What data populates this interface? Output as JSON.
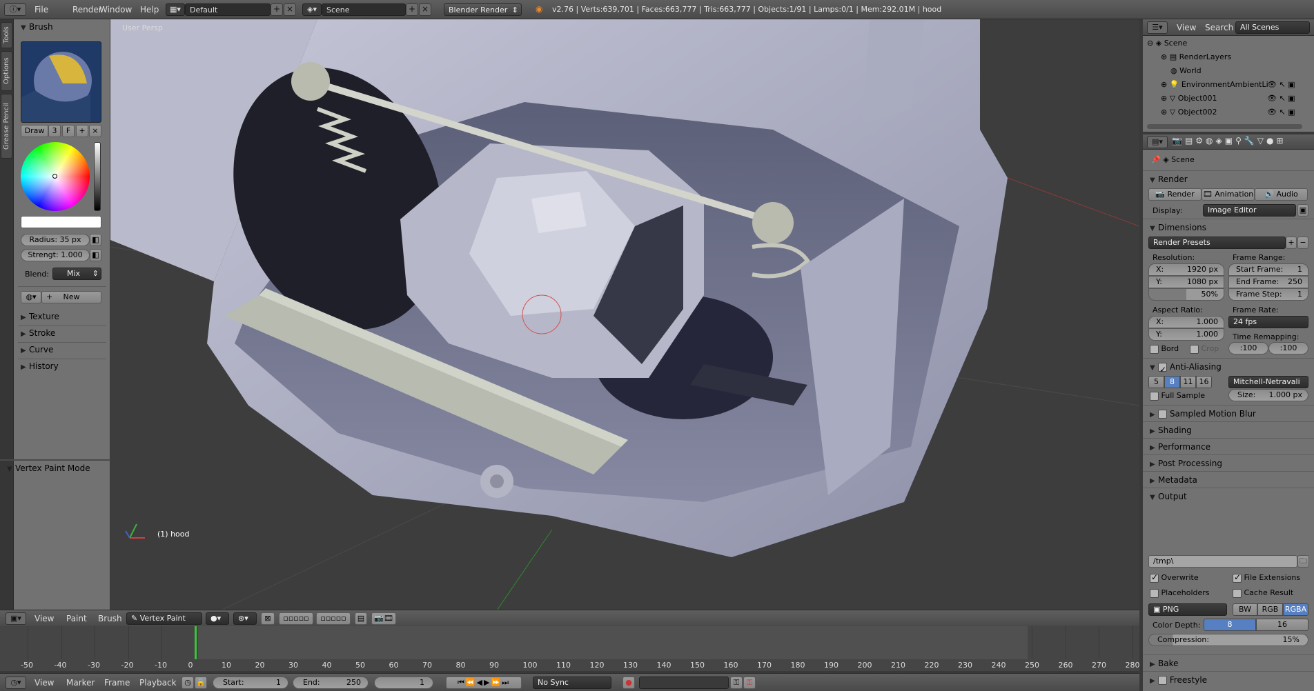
{
  "topbar": {
    "menus": [
      "File",
      "Render",
      "Window",
      "Help"
    ],
    "layout": "Default",
    "scene": "Scene",
    "engine": "Blender Render",
    "stats": "v2.76 | Verts:639,701 | Faces:663,777 | Tris:663,777 | Objects:1/91 | Lamps:0/1 | Mem:292.01M | hood"
  },
  "shelf_tabs": [
    "Tools",
    "Options",
    "Grease Pencil"
  ],
  "brush": {
    "panel": "Brush",
    "mode_label": "Draw",
    "count": "3",
    "fake_user": "F",
    "radius": "Radius: 35 px",
    "strength": "Strengt: 1.000",
    "blend_label": "Blend:",
    "blend_value": "Mix",
    "new_label": "New"
  },
  "tool_panels": [
    "Texture",
    "Stroke",
    "Curve",
    "History"
  ],
  "operator_panel": "Vertex Paint Mode",
  "viewport": {
    "view_name": "User Persp",
    "object_label": "(1) hood"
  },
  "outliner": {
    "menus": [
      "View",
      "Search"
    ],
    "filter": "All Scenes",
    "rows": [
      "Scene",
      "RenderLayers",
      "World",
      "EnvironmentAmbientLi",
      "Object001",
      "Object002"
    ]
  },
  "properties": {
    "context": "Scene",
    "render_section": "Render",
    "render_btn": "Render",
    "animation_btn": "Animation",
    "audio_btn": "Audio",
    "display_label": "Display:",
    "display_value": "Image Editor",
    "dimensions_section": "Dimensions",
    "render_presets": "Render Presets",
    "resolution_label": "Resolution:",
    "res_x": "X:",
    "res_x_val": "1920 px",
    "res_y": "Y:",
    "res_y_val": "1080 px",
    "res_pct": "50%",
    "frame_range_label": "Frame Range:",
    "start_frame": "Start Frame:",
    "start_val": "1",
    "end_frame": "End Frame:",
    "end_val": "250",
    "frame_step": "Frame Step:",
    "step_val": "1",
    "aspect_label": "Aspect Ratio:",
    "aspect_x": "X:",
    "aspect_x_val": "1.000",
    "aspect_y": "Y:",
    "aspect_y_val": "1.000",
    "frame_rate_label": "Frame Rate:",
    "fps": "24 fps",
    "time_remap_label": "Time Remapping:",
    "remap_old": ":100",
    "remap_new": ":100",
    "bord": "Bord",
    "crop": "Crop",
    "aa_section": "Anti-Aliasing",
    "aa_samples": [
      "5",
      "8",
      "11",
      "16"
    ],
    "aa_filter": "Mitchell-Netravali",
    "full_sample": "Full Sample",
    "size_label": "Size:",
    "size_val": "1.000 px",
    "collapsed": [
      "Sampled Motion Blur",
      "Shading",
      "Performance",
      "Post Processing",
      "Metadata"
    ],
    "output_section": "Output",
    "output_path": "/tmp\\",
    "overwrite": "Overwrite",
    "file_ext": "File Extensions",
    "placeholders": "Placeholders",
    "cache_result": "Cache Result",
    "format": "PNG",
    "bw": "BW",
    "rgb": "RGB",
    "rgba": "RGBA",
    "color_depth_label": "Color Depth:",
    "depth_8": "8",
    "depth_16": "16",
    "compression": "Compression:",
    "compression_val": "15%",
    "bake": "Bake",
    "freestyle": "Freestyle"
  },
  "view_header": {
    "menus": [
      "View",
      "Paint",
      "Brush"
    ],
    "mode": "Vertex Paint"
  },
  "timeline": {
    "ticks": [
      "-50",
      "-40",
      "-30",
      "-20",
      "-10",
      "0",
      "10",
      "20",
      "30",
      "40",
      "50",
      "60",
      "70",
      "80",
      "90",
      "100",
      "110",
      "120",
      "130",
      "140",
      "150",
      "160",
      "170",
      "180",
      "190",
      "200",
      "210",
      "220",
      "230",
      "240",
      "250",
      "260",
      "270",
      "280"
    ],
    "current_frame": 0
  },
  "timeline_header": {
    "menus": [
      "View",
      "Marker",
      "Frame",
      "Playback"
    ],
    "start_label": "Start:",
    "start_val": "1",
    "end_label": "End:",
    "end_val": "250",
    "current": "1",
    "sync": "No Sync"
  }
}
